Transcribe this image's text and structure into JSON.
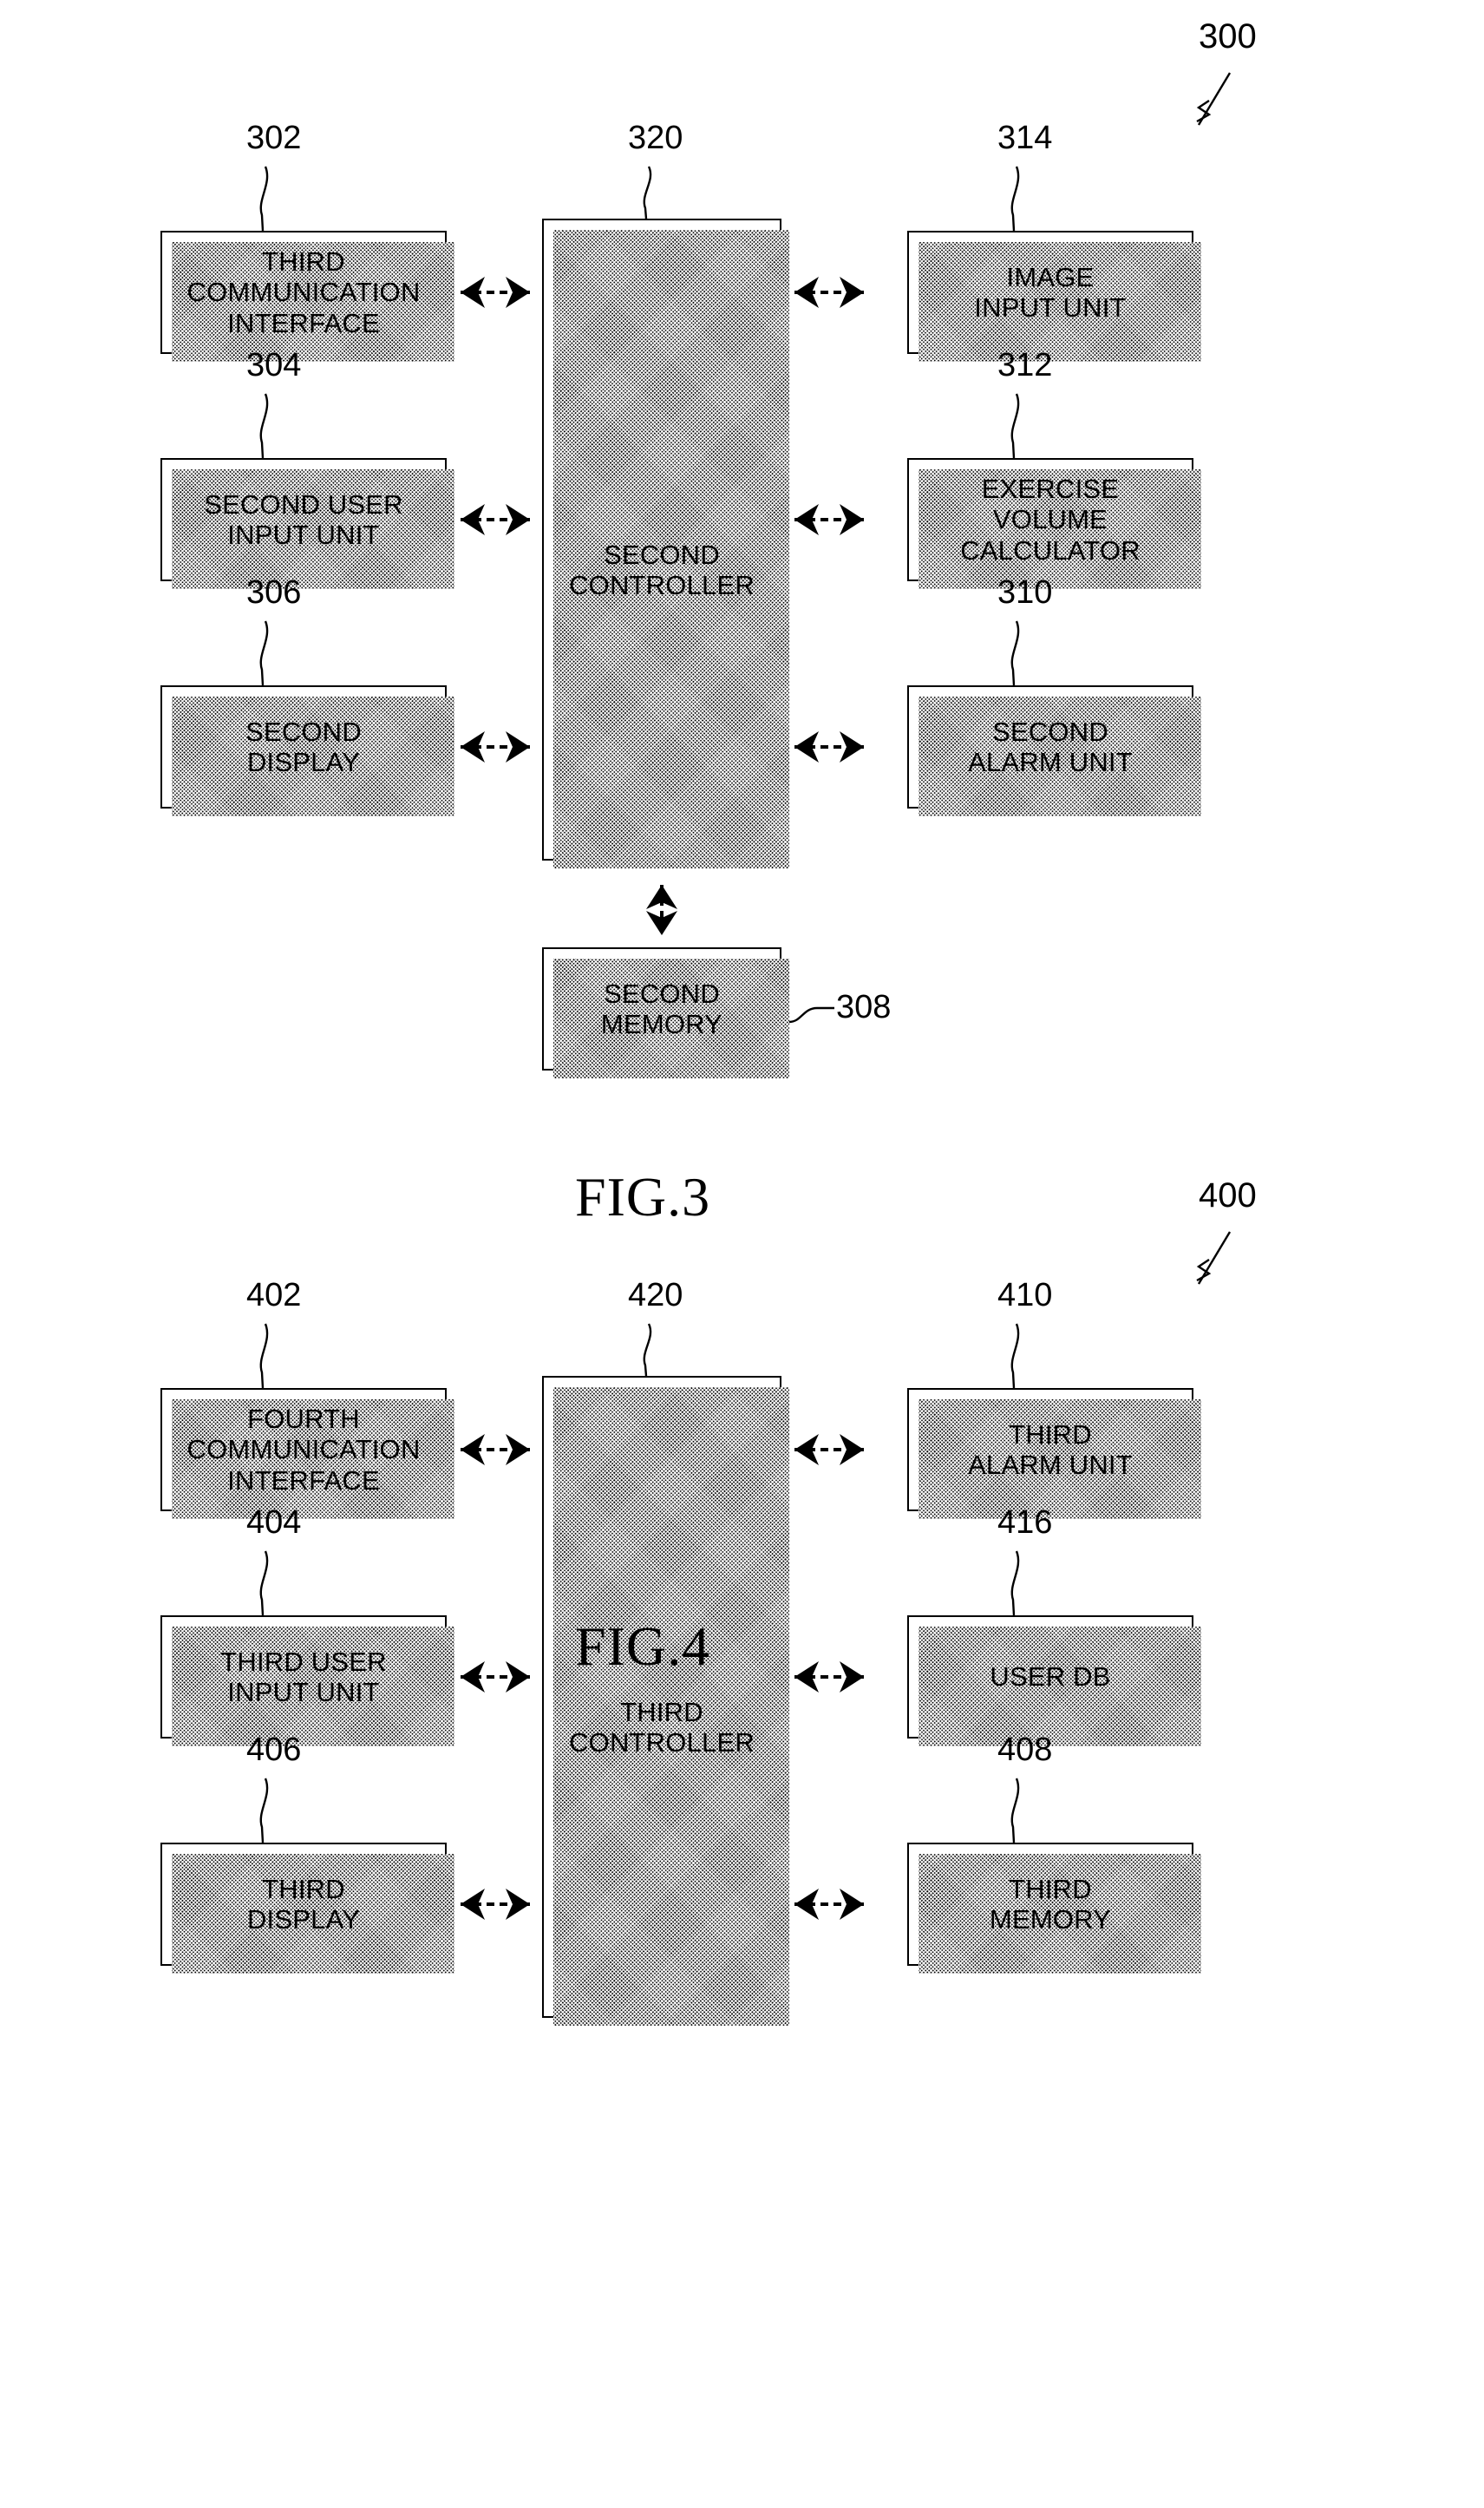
{
  "figures": [
    {
      "id": "fig3",
      "caption": "FIG.3",
      "system_numeral": "300",
      "left_column": [
        {
          "numeral": "302",
          "label": "THIRD\nCOMMUNICATION\nINTERFACE"
        },
        {
          "numeral": "304",
          "label": "SECOND USER\nINPUT UNIT"
        },
        {
          "numeral": "306",
          "label": "SECOND\nDISPLAY"
        }
      ],
      "center": {
        "numeral": "320",
        "label": "SECOND\nCONTROLLER"
      },
      "right_column": [
        {
          "numeral": "314",
          "label": "IMAGE\nINPUT UNIT"
        },
        {
          "numeral": "312",
          "label": "EXERCISE\nVOLUME\nCALCULATOR"
        },
        {
          "numeral": "310",
          "label": "SECOND\nALARM UNIT"
        }
      ],
      "bottom": {
        "numeral": "308",
        "label": "SECOND\nMEMORY"
      }
    },
    {
      "id": "fig4",
      "caption": "FIG.4",
      "system_numeral": "400",
      "left_column": [
        {
          "numeral": "402",
          "label": "FOURTH\nCOMMUNICATION\nINTERFACE"
        },
        {
          "numeral": "404",
          "label": "THIRD USER\nINPUT UNIT"
        },
        {
          "numeral": "406",
          "label": "THIRD\nDISPLAY"
        }
      ],
      "center": {
        "numeral": "420",
        "label": "THIRD\nCONTROLLER"
      },
      "right_column": [
        {
          "numeral": "410",
          "label": "THIRD\nALARM UNIT"
        },
        {
          "numeral": "416",
          "label": "USER DB"
        },
        {
          "numeral": "408",
          "label": "THIRD\nMEMORY"
        }
      ],
      "bottom": null
    }
  ],
  "colors": {
    "ink": "#000000",
    "paper": "#ffffff"
  }
}
